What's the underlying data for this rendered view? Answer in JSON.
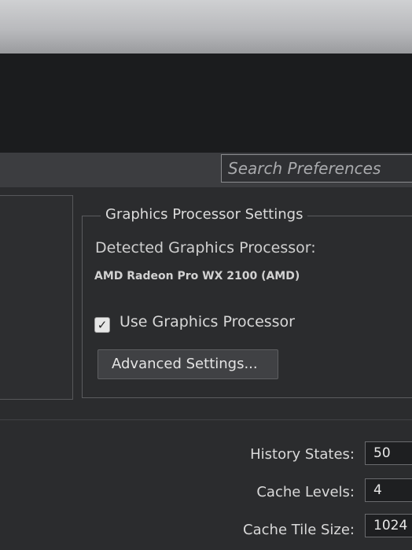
{
  "search": {
    "placeholder": "Search Preferences"
  },
  "gpu_settings": {
    "title": "Graphics Processor Settings",
    "detected_label": "Detected Graphics Processor:",
    "gpu_name": "AMD Radeon Pro WX 2100 (AMD)",
    "use_gpu_label": "Use Graphics Processor",
    "use_gpu_checked": true,
    "check_glyph": "✓",
    "advanced_button": "Advanced Settings..."
  },
  "history_cache": {
    "history_states_label": "History States:",
    "history_states_value": "50",
    "cache_levels_label": "Cache Levels:",
    "cache_levels_value": "4",
    "cache_tile_size_label": "Cache Tile Size:",
    "cache_tile_size_value": "1024"
  },
  "colors": {
    "panel_bg": "#2b2c2e",
    "header_bg": "#3c3d40",
    "button_bg": "#404144",
    "input_bg": "#1e1f21"
  }
}
